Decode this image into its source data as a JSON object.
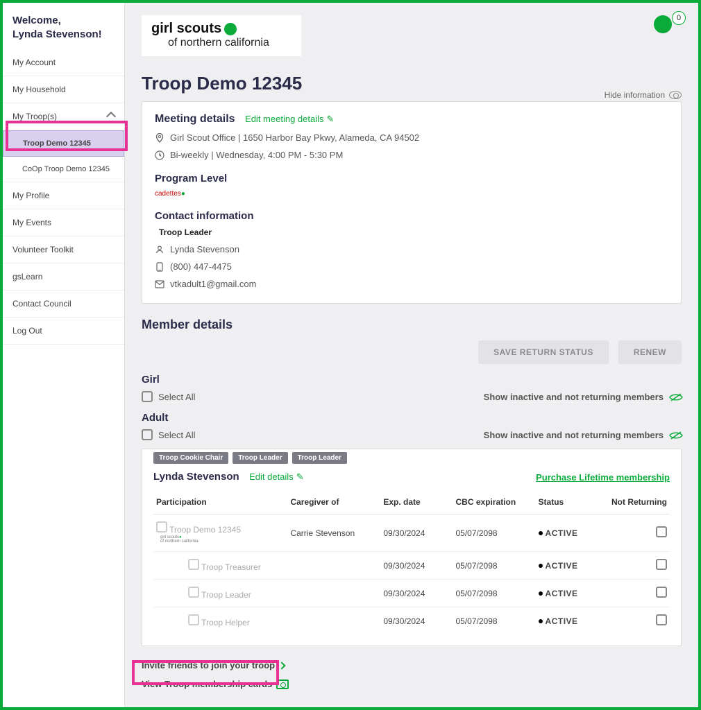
{
  "sidebar": {
    "welcome_line1": "Welcome,",
    "welcome_line2": "Lynda Stevenson!",
    "items": [
      {
        "label": "My Account"
      },
      {
        "label": "My Household"
      },
      {
        "label": "My Troop(s)",
        "expandable": true
      },
      {
        "label": "Troop Demo 12345",
        "child": true,
        "active": true
      },
      {
        "label": "CoOp Troop Demo 12345",
        "child": true
      },
      {
        "label": "My Profile"
      },
      {
        "label": "My Events"
      },
      {
        "label": "Volunteer Toolkit"
      },
      {
        "label": "gsLearn"
      },
      {
        "label": "Contact Council"
      },
      {
        "label": "Log Out"
      }
    ]
  },
  "header": {
    "logo_line1": "girl scouts",
    "logo_line2": "of northern california",
    "cart_count": "0"
  },
  "page": {
    "title": "Troop Demo 12345",
    "hide_info": "Hide information"
  },
  "meeting": {
    "section": "Meeting details",
    "edit": "Edit meeting details",
    "address": "Girl Scout Office | 1650 Harbor Bay Pkwy, Alameda, CA 94502",
    "schedule": "Bi-weekly | Wednesday, 4:00 PM - 5:30 PM",
    "program_h": "Program Level",
    "program_badge": "cadettes",
    "contact_h": "Contact information",
    "leader_label": "Troop Leader",
    "leader_name": "Lynda  Stevenson",
    "leader_phone": "(800) 447-4475",
    "leader_email": "vtkadult1@gmail.com"
  },
  "members": {
    "section": "Member details",
    "save_btn": "SAVE RETURN STATUS",
    "renew_btn": "RENEW",
    "girl_h": "Girl",
    "adult_h": "Adult",
    "select_all": "Select All",
    "show_inactive": "Show inactive and not returning members"
  },
  "member_card": {
    "tags": [
      "Troop Cookie Chair",
      "Troop Leader",
      "Troop Leader"
    ],
    "name": "Lynda Stevenson",
    "edit": "Edit details",
    "purchase": "Purchase Lifetime membership",
    "cols": {
      "participation": "Participation",
      "caregiver": "Caregiver of",
      "exp": "Exp. date",
      "cbc": "CBC expiration",
      "status": "Status",
      "not_returning": "Not Returning"
    },
    "rows": [
      {
        "participation": "Troop Demo 12345",
        "council": "girl scouts of northern california",
        "caregiver": "Carrie Stevenson",
        "exp": "09/30/2024",
        "cbc": "05/07/2098",
        "status": "ACTIVE"
      },
      {
        "participation": "Troop Treasurer",
        "caregiver": "",
        "exp": "09/30/2024",
        "cbc": "05/07/2098",
        "status": "ACTIVE"
      },
      {
        "participation": "Troop Leader",
        "caregiver": "",
        "exp": "09/30/2024",
        "cbc": "05/07/2098",
        "status": "ACTIVE"
      },
      {
        "participation": "Troop Helper",
        "caregiver": "",
        "exp": "09/30/2024",
        "cbc": "05/07/2098",
        "status": "ACTIVE"
      }
    ]
  },
  "bottom": {
    "invite": "Invite friends to join your troop",
    "view_cards": "View Troop membership cards"
  }
}
